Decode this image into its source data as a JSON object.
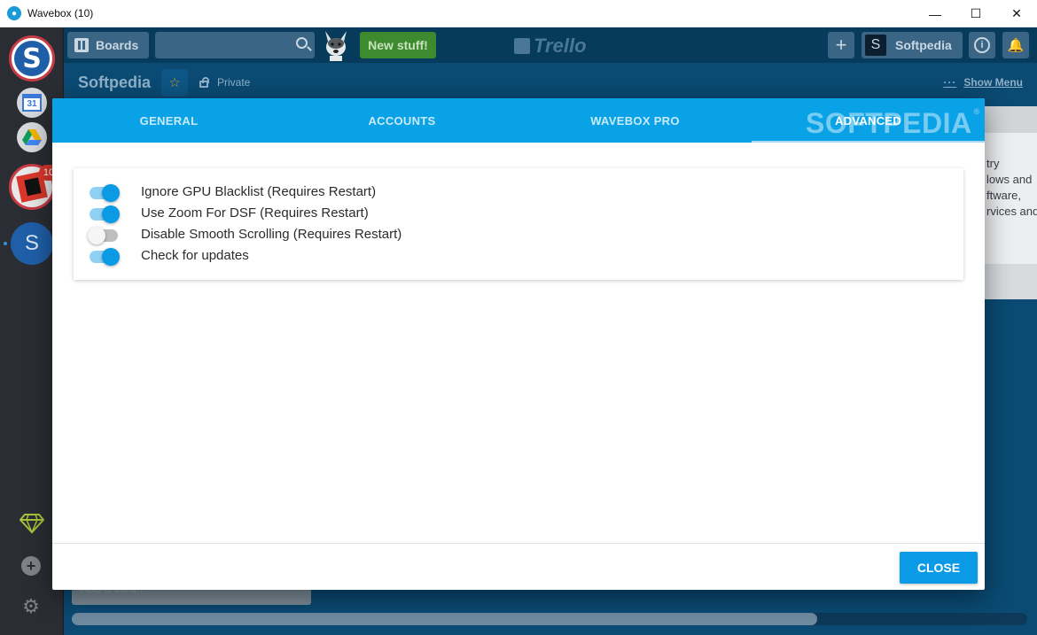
{
  "window": {
    "title": "Wavebox (10)",
    "minimize_glyph": "—",
    "maximize_glyph": "☐",
    "close_glyph": "✕"
  },
  "sidebar": {
    "primary_account_letter": "S",
    "calendar_day": "31",
    "office_badge": "10",
    "secondary_account_letter": "S",
    "add_glyph": "+",
    "gear_glyph": "⚙"
  },
  "trello": {
    "boards_label": "Boards",
    "new_stuff_label": "New stuff!",
    "logo_text": "Trello",
    "plus_glyph": "+",
    "user_initial": "S",
    "user_name": "Softpedia",
    "info_glyph": "i",
    "bell_glyph": "🔔",
    "board_title": "Softpedia",
    "star_glyph": "☆",
    "private_label": "Private",
    "menu_dots": "···",
    "show_menu_label": "Show Menu",
    "card_lines": [
      "try",
      "lows and",
      "ftware,",
      "rvices and"
    ],
    "add_card_label": "Add a card..."
  },
  "settings": {
    "tabs": [
      {
        "label": "GENERAL",
        "active": false
      },
      {
        "label": "ACCOUNTS",
        "active": false
      },
      {
        "label": "WAVEBOX PRO",
        "active": false
      },
      {
        "label": "ADVANCED",
        "active": true
      }
    ],
    "watermark": "SOFTPEDIA",
    "watermark_mark": "®",
    "toggles": [
      {
        "label": "Ignore GPU Blacklist (Requires Restart)",
        "checked": true
      },
      {
        "label": "Use Zoom For DSF (Requires Restart)",
        "checked": true
      },
      {
        "label": "Disable Smooth Scrolling (Requires Restart)",
        "checked": false
      },
      {
        "label": "Check for updates",
        "checked": true
      }
    ],
    "close_label": "CLOSE"
  },
  "colors": {
    "accent": "#0aa2e6",
    "trello_bg": "#0a4a73",
    "sidebar_bg": "#2a2d33"
  },
  "scroll": {
    "horizontal_thumb_fraction": 0.78
  }
}
